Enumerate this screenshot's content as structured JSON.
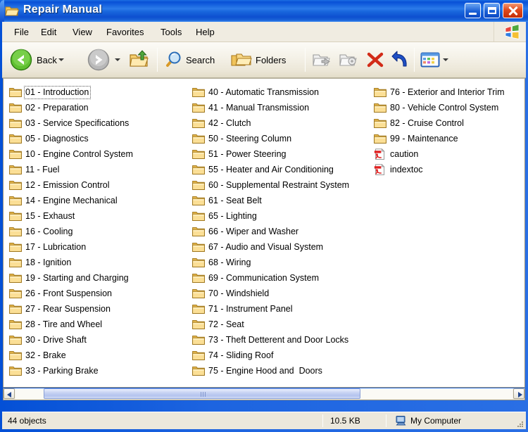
{
  "window": {
    "title": "Repair Manual",
    "title_icon": "folder-open-icon",
    "controls": {
      "minimize": "Minimize",
      "maximize": "Maximize",
      "close": "Close"
    }
  },
  "menubar": {
    "items": [
      "File",
      "Edit",
      "View",
      "Favorites",
      "Tools",
      "Help"
    ],
    "logo": "windows-flag-icon"
  },
  "toolbar": {
    "back": "Back",
    "forward": "Forward",
    "up": "Up",
    "search": "Search",
    "folders": "Folders",
    "move_to": "Move To",
    "copy_to": "Copy To",
    "delete": "Delete",
    "undo": "Undo",
    "views": "Views"
  },
  "files": {
    "columns": [
      [
        {
          "name": "01 - Introduction",
          "type": "folder",
          "focused": true
        },
        {
          "name": "02 - Preparation",
          "type": "folder"
        },
        {
          "name": "03 - Service Specifications",
          "type": "folder"
        },
        {
          "name": "05 - Diagnostics",
          "type": "folder"
        },
        {
          "name": "10 - Engine Control System",
          "type": "folder"
        },
        {
          "name": "11 - Fuel",
          "type": "folder"
        },
        {
          "name": "12 - Emission Control",
          "type": "folder"
        },
        {
          "name": "14 - Engine Mechanical",
          "type": "folder"
        },
        {
          "name": "15 - Exhaust",
          "type": "folder"
        },
        {
          "name": "16 - Cooling",
          "type": "folder"
        },
        {
          "name": "17 - Lubrication",
          "type": "folder"
        },
        {
          "name": "18 - Ignition",
          "type": "folder"
        },
        {
          "name": "19 - Starting and Charging",
          "type": "folder"
        },
        {
          "name": "26 - Front Suspension",
          "type": "folder"
        },
        {
          "name": "27 - Rear Suspension",
          "type": "folder"
        },
        {
          "name": "28 - Tire and Wheel",
          "type": "folder"
        },
        {
          "name": "30 - Drive Shaft",
          "type": "folder"
        },
        {
          "name": "32 - Brake",
          "type": "folder"
        },
        {
          "name": "33 - Parking Brake",
          "type": "folder"
        }
      ],
      [
        {
          "name": "40 - Automatic Transmission",
          "type": "folder"
        },
        {
          "name": "41 - Manual Transmission",
          "type": "folder"
        },
        {
          "name": "42 - Clutch",
          "type": "folder"
        },
        {
          "name": "50 - Steering Column",
          "type": "folder"
        },
        {
          "name": "51 - Power Steering",
          "type": "folder"
        },
        {
          "name": "55 - Heater and Air Conditioning",
          "type": "folder"
        },
        {
          "name": "60 - Supplemental Restraint System",
          "type": "folder"
        },
        {
          "name": "61 - Seat Belt",
          "type": "folder"
        },
        {
          "name": "65 - Lighting",
          "type": "folder"
        },
        {
          "name": "66 - Wiper and Washer",
          "type": "folder"
        },
        {
          "name": "67 - Audio and Visual System",
          "type": "folder"
        },
        {
          "name": "68 - Wiring",
          "type": "folder"
        },
        {
          "name": "69 - Communication System",
          "type": "folder"
        },
        {
          "name": "70 - Windshield",
          "type": "folder"
        },
        {
          "name": "71 - Instrument Panel",
          "type": "folder"
        },
        {
          "name": "72 - Seat",
          "type": "folder"
        },
        {
          "name": "73 - Theft Detterent and Door Locks",
          "type": "folder"
        },
        {
          "name": "74 - Sliding Roof",
          "type": "folder"
        },
        {
          "name": "75 - Engine Hood and  Doors",
          "type": "folder"
        }
      ],
      [
        {
          "name": "76 - Exterior and Interior Trim",
          "type": "folder"
        },
        {
          "name": "80 - Vehicle Control System",
          "type": "folder"
        },
        {
          "name": "82 - Cruise Control",
          "type": "folder"
        },
        {
          "name": "99 - Maintenance",
          "type": "folder"
        },
        {
          "name": "caution",
          "type": "pdf"
        },
        {
          "name": "indextoc",
          "type": "pdf"
        }
      ]
    ]
  },
  "statusbar": {
    "objects": "44 objects",
    "size": "10.5 KB",
    "location": "My Computer",
    "location_icon": "my-computer-icon"
  },
  "colors": {
    "title_blue": "#0a53d8",
    "close_red": "#e04a1d",
    "folder_yellow": "#fbdb84",
    "pdf_red": "#e02020",
    "toolbar_beige": "#f0ece1"
  }
}
